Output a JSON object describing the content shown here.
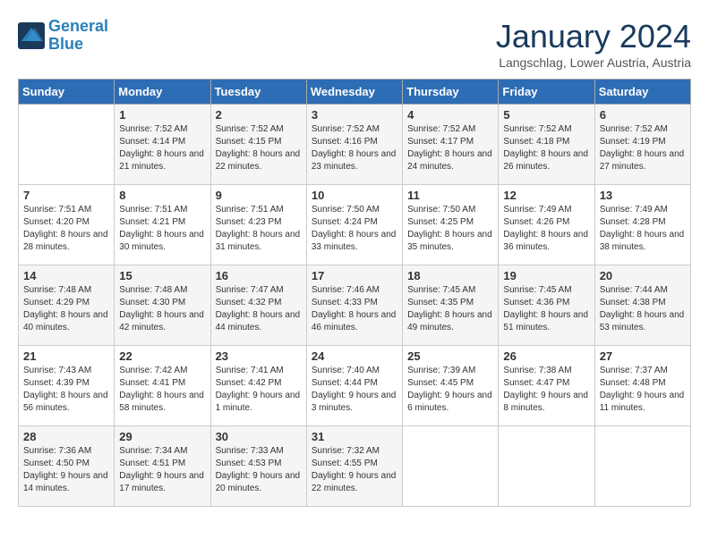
{
  "logo": {
    "line1": "General",
    "line2": "Blue"
  },
  "title": "January 2024",
  "subtitle": "Langschlag, Lower Austria, Austria",
  "days_of_week": [
    "Sunday",
    "Monday",
    "Tuesday",
    "Wednesday",
    "Thursday",
    "Friday",
    "Saturday"
  ],
  "weeks": [
    [
      {
        "day": "",
        "sunrise": "",
        "sunset": "",
        "daylight": ""
      },
      {
        "day": "1",
        "sunrise": "Sunrise: 7:52 AM",
        "sunset": "Sunset: 4:14 PM",
        "daylight": "Daylight: 8 hours and 21 minutes."
      },
      {
        "day": "2",
        "sunrise": "Sunrise: 7:52 AM",
        "sunset": "Sunset: 4:15 PM",
        "daylight": "Daylight: 8 hours and 22 minutes."
      },
      {
        "day": "3",
        "sunrise": "Sunrise: 7:52 AM",
        "sunset": "Sunset: 4:16 PM",
        "daylight": "Daylight: 8 hours and 23 minutes."
      },
      {
        "day": "4",
        "sunrise": "Sunrise: 7:52 AM",
        "sunset": "Sunset: 4:17 PM",
        "daylight": "Daylight: 8 hours and 24 minutes."
      },
      {
        "day": "5",
        "sunrise": "Sunrise: 7:52 AM",
        "sunset": "Sunset: 4:18 PM",
        "daylight": "Daylight: 8 hours and 26 minutes."
      },
      {
        "day": "6",
        "sunrise": "Sunrise: 7:52 AM",
        "sunset": "Sunset: 4:19 PM",
        "daylight": "Daylight: 8 hours and 27 minutes."
      }
    ],
    [
      {
        "day": "7",
        "sunrise": "Sunrise: 7:51 AM",
        "sunset": "Sunset: 4:20 PM",
        "daylight": "Daylight: 8 hours and 28 minutes."
      },
      {
        "day": "8",
        "sunrise": "Sunrise: 7:51 AM",
        "sunset": "Sunset: 4:21 PM",
        "daylight": "Daylight: 8 hours and 30 minutes."
      },
      {
        "day": "9",
        "sunrise": "Sunrise: 7:51 AM",
        "sunset": "Sunset: 4:23 PM",
        "daylight": "Daylight: 8 hours and 31 minutes."
      },
      {
        "day": "10",
        "sunrise": "Sunrise: 7:50 AM",
        "sunset": "Sunset: 4:24 PM",
        "daylight": "Daylight: 8 hours and 33 minutes."
      },
      {
        "day": "11",
        "sunrise": "Sunrise: 7:50 AM",
        "sunset": "Sunset: 4:25 PM",
        "daylight": "Daylight: 8 hours and 35 minutes."
      },
      {
        "day": "12",
        "sunrise": "Sunrise: 7:49 AM",
        "sunset": "Sunset: 4:26 PM",
        "daylight": "Daylight: 8 hours and 36 minutes."
      },
      {
        "day": "13",
        "sunrise": "Sunrise: 7:49 AM",
        "sunset": "Sunset: 4:28 PM",
        "daylight": "Daylight: 8 hours and 38 minutes."
      }
    ],
    [
      {
        "day": "14",
        "sunrise": "Sunrise: 7:48 AM",
        "sunset": "Sunset: 4:29 PM",
        "daylight": "Daylight: 8 hours and 40 minutes."
      },
      {
        "day": "15",
        "sunrise": "Sunrise: 7:48 AM",
        "sunset": "Sunset: 4:30 PM",
        "daylight": "Daylight: 8 hours and 42 minutes."
      },
      {
        "day": "16",
        "sunrise": "Sunrise: 7:47 AM",
        "sunset": "Sunset: 4:32 PM",
        "daylight": "Daylight: 8 hours and 44 minutes."
      },
      {
        "day": "17",
        "sunrise": "Sunrise: 7:46 AM",
        "sunset": "Sunset: 4:33 PM",
        "daylight": "Daylight: 8 hours and 46 minutes."
      },
      {
        "day": "18",
        "sunrise": "Sunrise: 7:45 AM",
        "sunset": "Sunset: 4:35 PM",
        "daylight": "Daylight: 8 hours and 49 minutes."
      },
      {
        "day": "19",
        "sunrise": "Sunrise: 7:45 AM",
        "sunset": "Sunset: 4:36 PM",
        "daylight": "Daylight: 8 hours and 51 minutes."
      },
      {
        "day": "20",
        "sunrise": "Sunrise: 7:44 AM",
        "sunset": "Sunset: 4:38 PM",
        "daylight": "Daylight: 8 hours and 53 minutes."
      }
    ],
    [
      {
        "day": "21",
        "sunrise": "Sunrise: 7:43 AM",
        "sunset": "Sunset: 4:39 PM",
        "daylight": "Daylight: 8 hours and 56 minutes."
      },
      {
        "day": "22",
        "sunrise": "Sunrise: 7:42 AM",
        "sunset": "Sunset: 4:41 PM",
        "daylight": "Daylight: 8 hours and 58 minutes."
      },
      {
        "day": "23",
        "sunrise": "Sunrise: 7:41 AM",
        "sunset": "Sunset: 4:42 PM",
        "daylight": "Daylight: 9 hours and 1 minute."
      },
      {
        "day": "24",
        "sunrise": "Sunrise: 7:40 AM",
        "sunset": "Sunset: 4:44 PM",
        "daylight": "Daylight: 9 hours and 3 minutes."
      },
      {
        "day": "25",
        "sunrise": "Sunrise: 7:39 AM",
        "sunset": "Sunset: 4:45 PM",
        "daylight": "Daylight: 9 hours and 6 minutes."
      },
      {
        "day": "26",
        "sunrise": "Sunrise: 7:38 AM",
        "sunset": "Sunset: 4:47 PM",
        "daylight": "Daylight: 9 hours and 8 minutes."
      },
      {
        "day": "27",
        "sunrise": "Sunrise: 7:37 AM",
        "sunset": "Sunset: 4:48 PM",
        "daylight": "Daylight: 9 hours and 11 minutes."
      }
    ],
    [
      {
        "day": "28",
        "sunrise": "Sunrise: 7:36 AM",
        "sunset": "Sunset: 4:50 PM",
        "daylight": "Daylight: 9 hours and 14 minutes."
      },
      {
        "day": "29",
        "sunrise": "Sunrise: 7:34 AM",
        "sunset": "Sunset: 4:51 PM",
        "daylight": "Daylight: 9 hours and 17 minutes."
      },
      {
        "day": "30",
        "sunrise": "Sunrise: 7:33 AM",
        "sunset": "Sunset: 4:53 PM",
        "daylight": "Daylight: 9 hours and 20 minutes."
      },
      {
        "day": "31",
        "sunrise": "Sunrise: 7:32 AM",
        "sunset": "Sunset: 4:55 PM",
        "daylight": "Daylight: 9 hours and 22 minutes."
      },
      {
        "day": "",
        "sunrise": "",
        "sunset": "",
        "daylight": ""
      },
      {
        "day": "",
        "sunrise": "",
        "sunset": "",
        "daylight": ""
      },
      {
        "day": "",
        "sunrise": "",
        "sunset": "",
        "daylight": ""
      }
    ]
  ]
}
